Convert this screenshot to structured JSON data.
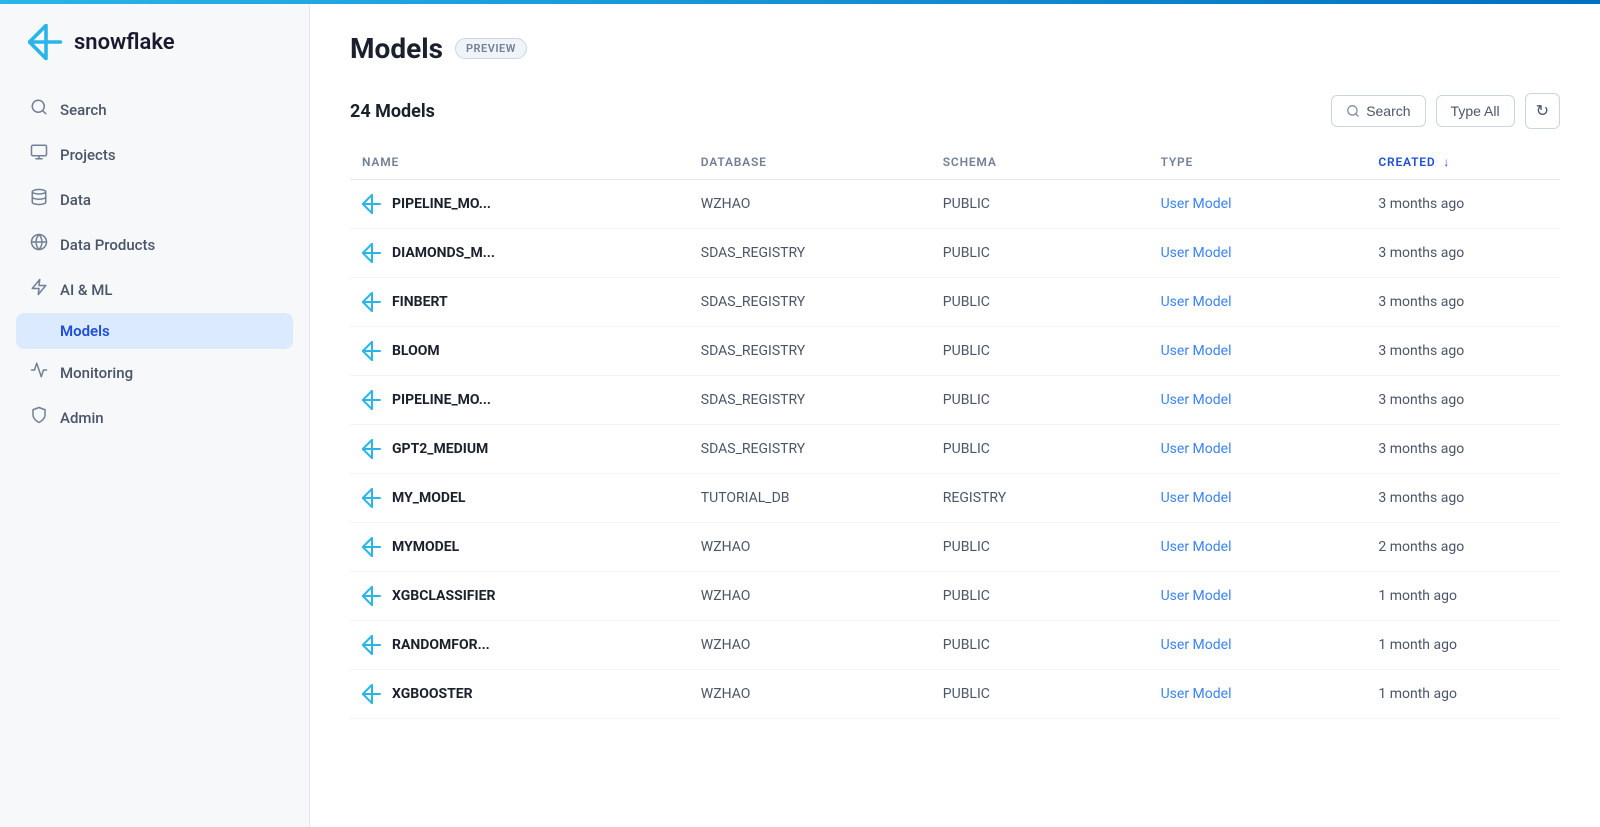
{
  "topbar": {
    "progress_color": "#29B5E8"
  },
  "sidebar": {
    "logo_text": "snowflake",
    "nav_items": [
      {
        "id": "search",
        "label": "Search",
        "icon": "🔍",
        "active": false
      },
      {
        "id": "projects",
        "label": "Projects",
        "icon": "🖥",
        "active": false
      },
      {
        "id": "data",
        "label": "Data",
        "icon": "🗄",
        "active": false
      },
      {
        "id": "data-products",
        "label": "Data Products",
        "icon": "☁",
        "active": false
      },
      {
        "id": "ai-ml",
        "label": "AI & ML",
        "icon": "✦",
        "active": false
      }
    ],
    "sub_items": [
      {
        "id": "models",
        "label": "Models",
        "active": true
      }
    ],
    "bottom_items": [
      {
        "id": "monitoring",
        "label": "Monitoring",
        "icon": "📈",
        "active": false
      },
      {
        "id": "admin",
        "label": "Admin",
        "icon": "🛡",
        "active": false
      }
    ]
  },
  "main": {
    "page_title": "Models",
    "preview_badge": "PREVIEW",
    "models_count": "24 Models",
    "search_label": "Search",
    "type_label": "Type",
    "type_value": "All",
    "refresh_icon": "↻",
    "table": {
      "columns": [
        {
          "id": "name",
          "label": "NAME",
          "sorted": false
        },
        {
          "id": "database",
          "label": "DATABASE",
          "sorted": false
        },
        {
          "id": "schema",
          "label": "SCHEMA",
          "sorted": false
        },
        {
          "id": "type",
          "label": "TYPE",
          "sorted": false
        },
        {
          "id": "created",
          "label": "CREATED",
          "sorted": true,
          "sort_dir": "↓"
        }
      ],
      "rows": [
        {
          "name": "PIPELINE_MO...",
          "database": "WZHAO",
          "schema": "PUBLIC",
          "type": "User Model",
          "created": "3 months ago"
        },
        {
          "name": "DIAMONDS_M...",
          "database": "SDAS_REGISTRY",
          "schema": "PUBLIC",
          "type": "User Model",
          "created": "3 months ago"
        },
        {
          "name": "FINBERT",
          "database": "SDAS_REGISTRY",
          "schema": "PUBLIC",
          "type": "User Model",
          "created": "3 months ago"
        },
        {
          "name": "BLOOM",
          "database": "SDAS_REGISTRY",
          "schema": "PUBLIC",
          "type": "User Model",
          "created": "3 months ago"
        },
        {
          "name": "PIPELINE_MO...",
          "database": "SDAS_REGISTRY",
          "schema": "PUBLIC",
          "type": "User Model",
          "created": "3 months ago"
        },
        {
          "name": "GPT2_MEDIUM",
          "database": "SDAS_REGISTRY",
          "schema": "PUBLIC",
          "type": "User Model",
          "created": "3 months ago"
        },
        {
          "name": "MY_MODEL",
          "database": "TUTORIAL_DB",
          "schema": "REGISTRY",
          "type": "User Model",
          "created": "3 months ago"
        },
        {
          "name": "MYMODEL",
          "database": "WZHAO",
          "schema": "PUBLIC",
          "type": "User Model",
          "created": "2 months ago"
        },
        {
          "name": "XGBCLASSIFIER",
          "database": "WZHAO",
          "schema": "PUBLIC",
          "type": "User Model",
          "created": "1 month ago"
        },
        {
          "name": "RANDOMFOR...",
          "database": "WZHAO",
          "schema": "PUBLIC",
          "type": "User Model",
          "created": "1 month ago"
        },
        {
          "name": "XGBOOSTER",
          "database": "WZHAO",
          "schema": "PUBLIC",
          "type": "User Model",
          "created": "1 month ago"
        }
      ]
    }
  }
}
